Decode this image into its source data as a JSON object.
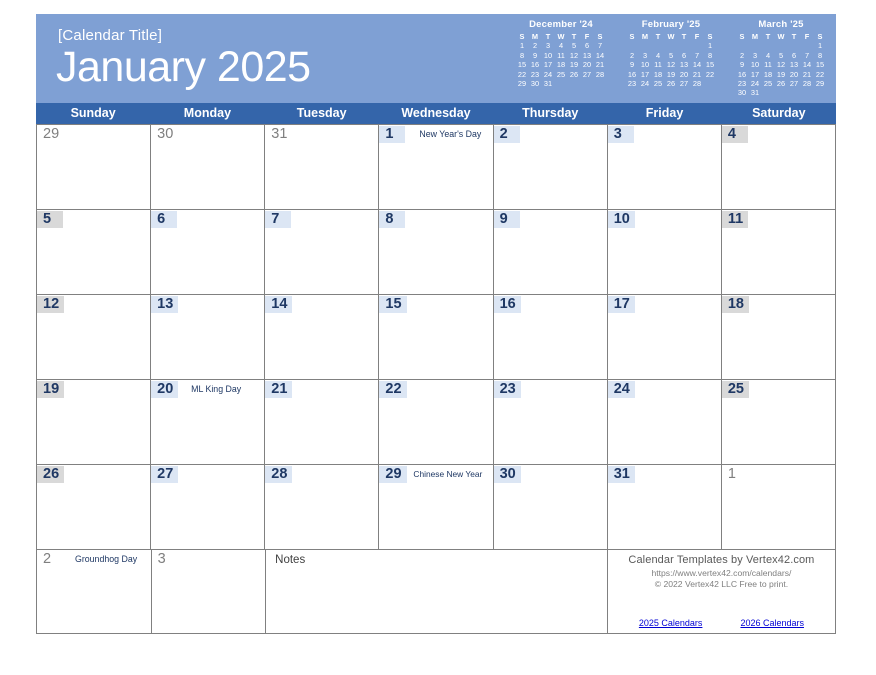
{
  "header": {
    "calendar_title": "[Calendar Title]",
    "month_title": "January 2025",
    "banner_color": "#7fa0d4",
    "dow_bar_color": "#3465aa"
  },
  "mini_calendars": [
    {
      "title": "December '24",
      "dow": [
        "S",
        "M",
        "T",
        "W",
        "T",
        "F",
        "S"
      ],
      "weeks": [
        [
          "1",
          "2",
          "3",
          "4",
          "5",
          "6",
          "7"
        ],
        [
          "8",
          "9",
          "10",
          "11",
          "12",
          "13",
          "14"
        ],
        [
          "15",
          "16",
          "17",
          "18",
          "19",
          "20",
          "21"
        ],
        [
          "22",
          "23",
          "24",
          "25",
          "26",
          "27",
          "28"
        ],
        [
          "29",
          "30",
          "31",
          "",
          "",
          "",
          ""
        ]
      ]
    },
    {
      "title": "February '25",
      "dow": [
        "S",
        "M",
        "T",
        "W",
        "T",
        "F",
        "S"
      ],
      "weeks": [
        [
          "",
          "",
          "",
          "",
          "",
          "",
          "1"
        ],
        [
          "2",
          "3",
          "4",
          "5",
          "6",
          "7",
          "8"
        ],
        [
          "9",
          "10",
          "11",
          "12",
          "13",
          "14",
          "15"
        ],
        [
          "16",
          "17",
          "18",
          "19",
          "20",
          "21",
          "22"
        ],
        [
          "23",
          "24",
          "25",
          "26",
          "27",
          "28",
          ""
        ]
      ]
    },
    {
      "title": "March '25",
      "dow": [
        "S",
        "M",
        "T",
        "W",
        "T",
        "F",
        "S"
      ],
      "weeks": [
        [
          "",
          "",
          "",
          "",
          "",
          "",
          "1"
        ],
        [
          "2",
          "3",
          "4",
          "5",
          "6",
          "7",
          "8"
        ],
        [
          "9",
          "10",
          "11",
          "12",
          "13",
          "14",
          "15"
        ],
        [
          "16",
          "17",
          "18",
          "19",
          "20",
          "21",
          "22"
        ],
        [
          "23",
          "24",
          "25",
          "26",
          "27",
          "28",
          "29"
        ],
        [
          "30",
          "31",
          "",
          "",
          "",
          "",
          ""
        ]
      ]
    }
  ],
  "weekday_headers": [
    "Sunday",
    "Monday",
    "Tuesday",
    "Wednesday",
    "Thursday",
    "Friday",
    "Saturday"
  ],
  "weeks": [
    [
      {
        "day": "29",
        "style": "out",
        "event": ""
      },
      {
        "day": "30",
        "style": "out",
        "event": ""
      },
      {
        "day": "31",
        "style": "out",
        "event": ""
      },
      {
        "day": "1",
        "style": "wk",
        "event": "New Year's Day"
      },
      {
        "day": "2",
        "style": "wk",
        "event": ""
      },
      {
        "day": "3",
        "style": "wk",
        "event": ""
      },
      {
        "day": "4",
        "style": "we",
        "event": ""
      }
    ],
    [
      {
        "day": "5",
        "style": "we",
        "event": ""
      },
      {
        "day": "6",
        "style": "wk",
        "event": ""
      },
      {
        "day": "7",
        "style": "wk",
        "event": ""
      },
      {
        "day": "8",
        "style": "wk",
        "event": ""
      },
      {
        "day": "9",
        "style": "wk",
        "event": ""
      },
      {
        "day": "10",
        "style": "wk",
        "event": ""
      },
      {
        "day": "11",
        "style": "we",
        "event": ""
      }
    ],
    [
      {
        "day": "12",
        "style": "we",
        "event": ""
      },
      {
        "day": "13",
        "style": "wk",
        "event": ""
      },
      {
        "day": "14",
        "style": "wk",
        "event": ""
      },
      {
        "day": "15",
        "style": "wk",
        "event": ""
      },
      {
        "day": "16",
        "style": "wk",
        "event": ""
      },
      {
        "day": "17",
        "style": "wk",
        "event": ""
      },
      {
        "day": "18",
        "style": "we",
        "event": ""
      }
    ],
    [
      {
        "day": "19",
        "style": "we",
        "event": ""
      },
      {
        "day": "20",
        "style": "wk",
        "event": "ML King Day"
      },
      {
        "day": "21",
        "style": "wk",
        "event": ""
      },
      {
        "day": "22",
        "style": "wk",
        "event": ""
      },
      {
        "day": "23",
        "style": "wk",
        "event": ""
      },
      {
        "day": "24",
        "style": "wk",
        "event": ""
      },
      {
        "day": "25",
        "style": "we",
        "event": ""
      }
    ],
    [
      {
        "day": "26",
        "style": "we",
        "event": ""
      },
      {
        "day": "27",
        "style": "wk",
        "event": ""
      },
      {
        "day": "28",
        "style": "wk",
        "event": ""
      },
      {
        "day": "29",
        "style": "wk",
        "event": "Chinese New Year"
      },
      {
        "day": "30",
        "style": "wk",
        "event": ""
      },
      {
        "day": "31",
        "style": "wk",
        "event": ""
      },
      {
        "day": "1",
        "style": "out",
        "event": ""
      }
    ]
  ],
  "last_row": {
    "cells": [
      {
        "day": "2",
        "style": "out",
        "event": "Groundhog Day"
      },
      {
        "day": "3",
        "style": "out",
        "event": ""
      }
    ],
    "notes_label": "Notes"
  },
  "footer": {
    "line1": "Calendar Templates by Vertex42.com",
    "line2": "https://www.vertex42.com/calendars/",
    "line3": "© 2022 Vertex42 LLC  Free to print.",
    "link1": "2025 Calendars",
    "link2": "2026 Calendars",
    "link_color": "#0000d4"
  }
}
